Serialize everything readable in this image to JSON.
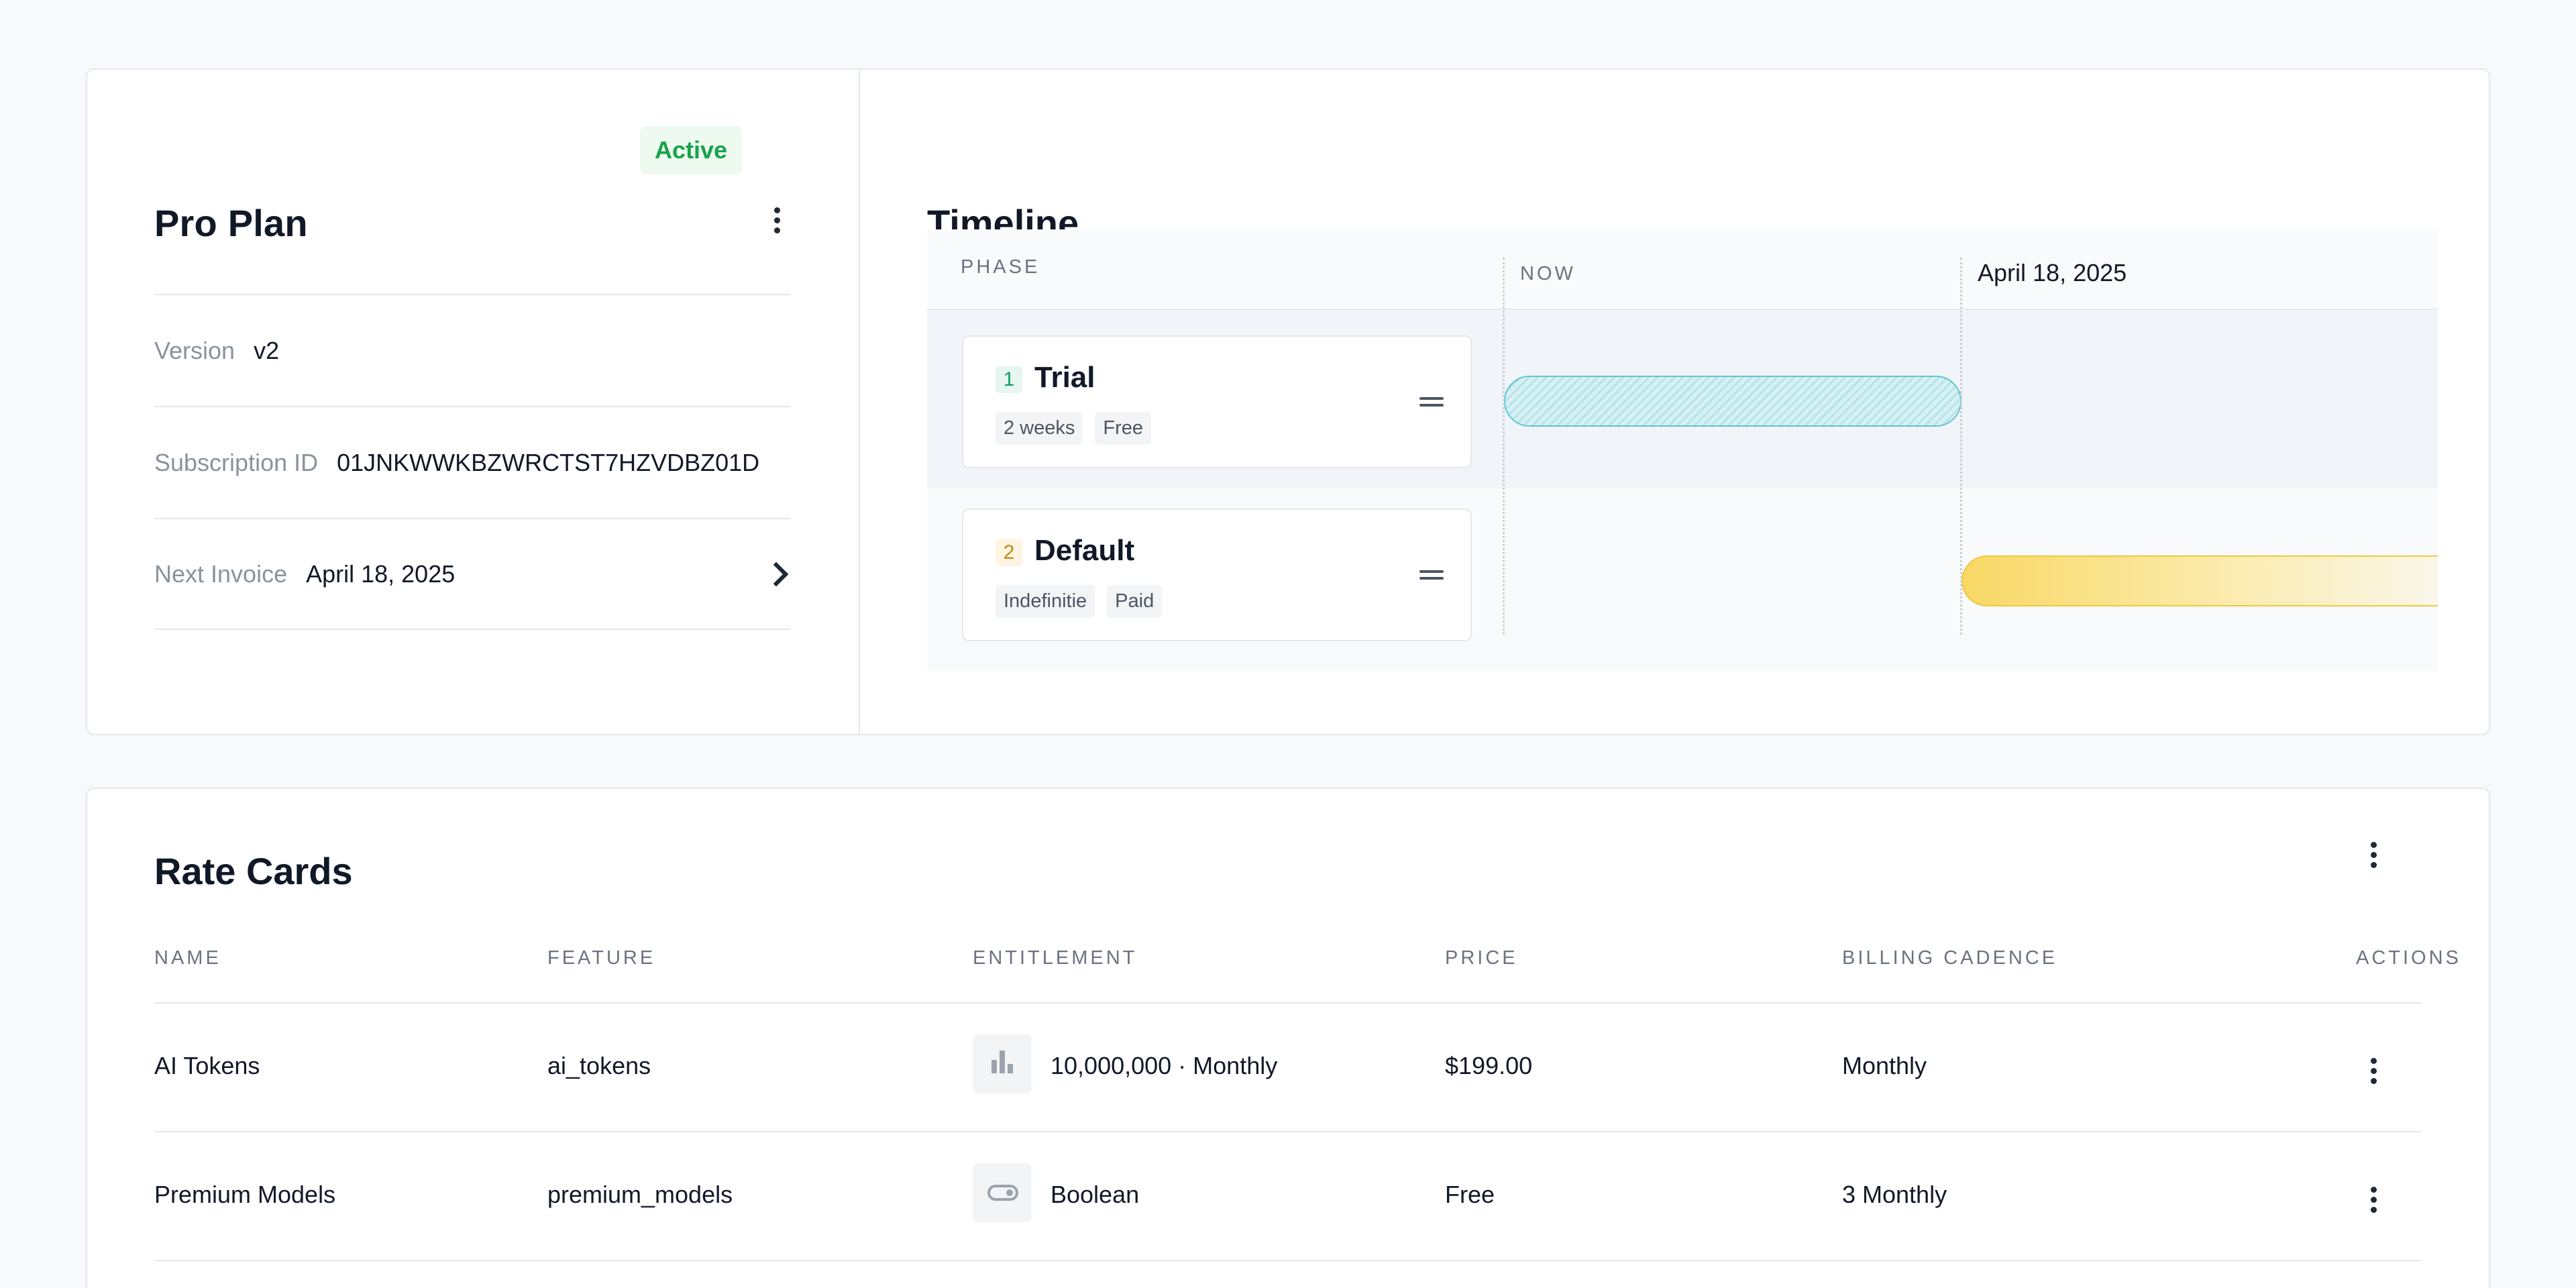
{
  "plan": {
    "title": "Pro Plan",
    "status": "Active",
    "fields": [
      {
        "label": "Version",
        "value": "v2"
      },
      {
        "label": "Subscription ID",
        "value": "01JNKWWKBZWRCTST7HZVDBZ01D"
      },
      {
        "label": "Next Invoice",
        "value": "April 18, 2025"
      }
    ]
  },
  "timeline": {
    "title": "Timeline",
    "header": {
      "phase": "PHASE",
      "now": "NOW",
      "date": "April 18, 2025"
    },
    "phases": [
      {
        "index": "1",
        "name": "Trial",
        "tags": [
          "2 weeks",
          "Free"
        ]
      },
      {
        "index": "2",
        "name": "Default",
        "tags": [
          "Indefinitie",
          "Paid"
        ]
      }
    ]
  },
  "rate_cards": {
    "title": "Rate Cards",
    "columns": [
      "NAME",
      "FEATURE",
      "ENTITLEMENT",
      "PRICE",
      "BILLING CADENCE",
      "ACTIONS"
    ],
    "rows": [
      {
        "name": "AI Tokens",
        "feature": "ai_tokens",
        "entitlement_icon": "bar-chart-icon",
        "entitlement": "10,000,000 · Monthly",
        "price": "$199.00",
        "cadence": "Monthly"
      },
      {
        "name": "Premium Models",
        "feature": "premium_models",
        "entitlement_icon": "toggle-icon",
        "entitlement": "Boolean",
        "price": "Free",
        "cadence": "3 Monthly"
      }
    ]
  },
  "colors": {
    "active_green": "#16a34a",
    "trial_teal": "#5ec6d0",
    "default_amber": "#f0c93a"
  }
}
